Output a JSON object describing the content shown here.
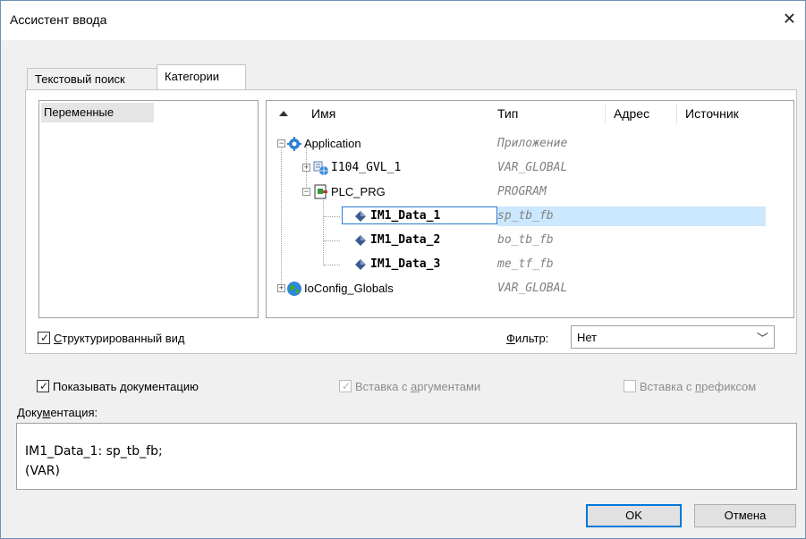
{
  "window": {
    "title": "Ассистент ввода",
    "close_glyph": "✕"
  },
  "tabs": [
    {
      "label": "Текстовый поиск",
      "active": false
    },
    {
      "label": "Категории",
      "active": true
    }
  ],
  "categories": {
    "items": [
      "Переменные"
    ],
    "selected_index": 0
  },
  "tree": {
    "columns": [
      "Имя",
      "Тип",
      "Адрес",
      "Источник"
    ],
    "sort_column": "Имя",
    "rows": [
      {
        "name": "Application",
        "type": "Приложение",
        "icon": "gear-icon",
        "expander": "−"
      },
      {
        "name": "I104_GVL_1",
        "type": "VAR_GLOBAL",
        "icon": "globe-list-icon",
        "expander": "+"
      },
      {
        "name": "PLC_PRG",
        "type": "PROGRAM",
        "icon": "program-block-icon",
        "expander": "−"
      },
      {
        "name": "IM1_Data_1",
        "type": "sp_tb_fb",
        "icon": "variable-diamond-icon",
        "selected": true
      },
      {
        "name": "IM1_Data_2",
        "type": "bo_tb_fb",
        "icon": "variable-diamond-icon"
      },
      {
        "name": "IM1_Data_3",
        "type": "me_tf_fb",
        "icon": "variable-diamond-icon"
      },
      {
        "name": "IoConfig_Globals",
        "type": "VAR_GLOBAL",
        "icon": "earth-globe-icon",
        "expander": "+"
      }
    ]
  },
  "options": {
    "structured_view": {
      "label_pre": "",
      "label_u": "С",
      "label_post": "труктурированный вид",
      "checked": true
    },
    "filter": {
      "label_pre": "",
      "label_u": "Ф",
      "label_post": "ильтр:",
      "value": "Нет"
    },
    "show_docs": {
      "label_pre": "Показывать ",
      "label_u": "д",
      "label_post": "окументацию",
      "checked": true
    },
    "insert_args": {
      "label_pre": "Вставка с ",
      "label_u": "а",
      "label_post": "ргументами",
      "checked": true,
      "enabled": false
    },
    "insert_prefix": {
      "label_pre": "Вставка с ",
      "label_u": "п",
      "label_post": "рефиксом",
      "checked": false,
      "enabled": false
    }
  },
  "documentation": {
    "label_pre": "Доку",
    "label_u": "м",
    "label_post": "ентация:",
    "lines": [
      "IM1_Data_1: sp_tb_fb;",
      "(VAR)"
    ]
  },
  "buttons": {
    "ok": "OK",
    "cancel": "Отмена"
  }
}
